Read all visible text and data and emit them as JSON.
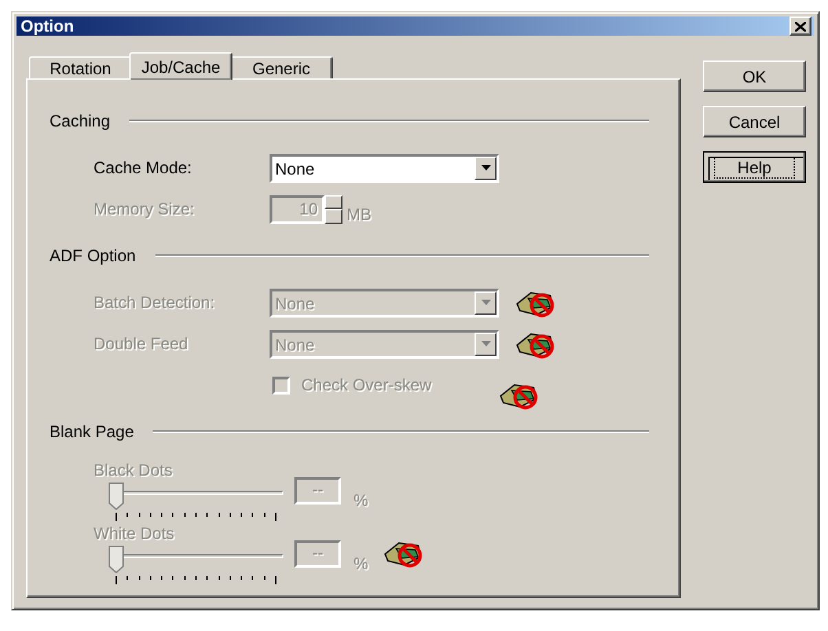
{
  "window": {
    "title": "Option"
  },
  "tabs": [
    {
      "label": "Rotation",
      "selected": false
    },
    {
      "label": "Job/Cache",
      "selected": true
    },
    {
      "label": "Generic",
      "selected": false
    }
  ],
  "sections": [
    {
      "title": "Caching",
      "rows": [
        {
          "kind": "combo",
          "label": "Cache Mode:",
          "value": "None",
          "disabled": false,
          "unavailable": false
        },
        {
          "kind": "spin",
          "label": "Memory Size:",
          "value": "10",
          "unit": "MB",
          "disabled": true,
          "unavailable": false
        }
      ]
    },
    {
      "title": "ADF Option",
      "rows": [
        {
          "kind": "combo",
          "label": "Batch Detection:",
          "value": "None",
          "disabled": true,
          "unavailable": true
        },
        {
          "kind": "combo",
          "label": "Double Feed",
          "value": "None",
          "disabled": true,
          "unavailable": true
        },
        {
          "kind": "checkbox",
          "label": "Check Over-skew",
          "checked": false,
          "disabled": true,
          "unavailable": true
        }
      ]
    },
    {
      "title": "Blank Page",
      "rows": [
        {
          "kind": "slider",
          "label": "Black Dots",
          "level": 0,
          "value": "--",
          "unit": "%",
          "disabled": true,
          "unavailable": false
        },
        {
          "kind": "slider",
          "label": "White Dots",
          "level": 0,
          "value": "--",
          "unit": "%",
          "disabled": true,
          "unavailable": true
        }
      ]
    }
  ],
  "buttons": [
    {
      "label": "OK",
      "focused": false
    },
    {
      "label": "Cancel",
      "focused": false
    },
    {
      "label": "Help",
      "focused": true
    }
  ]
}
